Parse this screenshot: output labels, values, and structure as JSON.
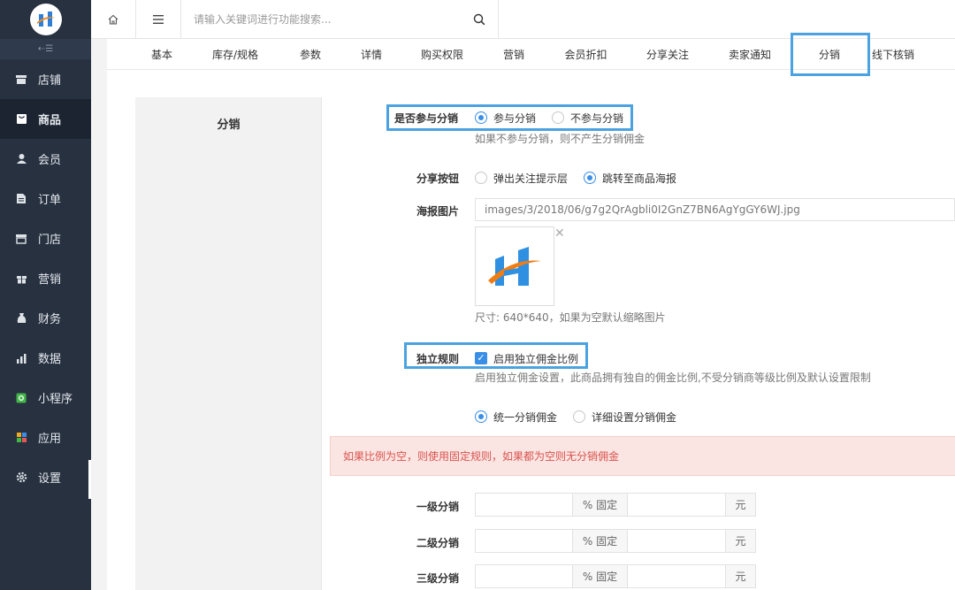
{
  "sidebar": {
    "collapse_icon": "collapse-icon",
    "items": [
      {
        "label": "店铺",
        "icon": "store-icon"
      },
      {
        "label": "商品",
        "icon": "goods-icon"
      },
      {
        "label": "会员",
        "icon": "member-icon"
      },
      {
        "label": "订单",
        "icon": "order-icon"
      },
      {
        "label": "门店",
        "icon": "shop-icon"
      },
      {
        "label": "营销",
        "icon": "gift-icon"
      },
      {
        "label": "财务",
        "icon": "money-bag-icon"
      },
      {
        "label": "数据",
        "icon": "chart-icon"
      },
      {
        "label": "小程序",
        "icon": "miniapp-icon"
      },
      {
        "label": "应用",
        "icon": "apps-icon"
      },
      {
        "label": "设置",
        "icon": "gear-icon"
      }
    ],
    "active_index": 1
  },
  "topbar": {
    "search_placeholder": "请输入关键词进行功能搜索..."
  },
  "tabs": [
    "基本",
    "库存/规格",
    "参数",
    "详情",
    "购买权限",
    "营销",
    "会员折扣",
    "分享关注",
    "卖家通知",
    "分销",
    "线下核销"
  ],
  "active_tab": "分销",
  "form": {
    "section_title": "分销",
    "participate": {
      "label": "是否参与分销",
      "option_yes": "参与分销",
      "option_no": "不参与分销",
      "hint": "如果不参与分销，则不产生分销佣金"
    },
    "share_button": {
      "label": "分享按钮",
      "option_popup": "弹出关注提示层",
      "option_poster": "跳转至商品海报"
    },
    "poster_image": {
      "label": "海报图片",
      "path": "images/3/2018/06/g7g2QrAgbli0I2GnZ7BN6AgYgGY6WJ.jpg",
      "remove_icon": "close-icon",
      "size_hint": "尺寸: 640*640，如果为空默认缩略图片"
    },
    "independent_rule": {
      "label": "独立规则",
      "checkbox_label": "启用独立佣金比例",
      "hint": "启用独立佣金设置，此商品拥有独自的佣金比例,不受分销商等级比例及默认设置限制",
      "option_unified": "统一分销佣金",
      "option_detailed": "详细设置分销佣金"
    },
    "alert": "如果比例为空，则使用固定规则，如果都为空则无分销佣金",
    "levels": [
      {
        "label": "一级分销",
        "percent_addon": "% 固定",
        "unit": "元"
      },
      {
        "label": "二级分销",
        "percent_addon": "% 固定",
        "unit": "元"
      },
      {
        "label": "三级分销",
        "percent_addon": "% 固定",
        "unit": "元"
      }
    ]
  },
  "colors": {
    "sidebar_bg": "#273140",
    "accent": "#3a8ee6",
    "highlight_box": "#4aa3e0",
    "alert_text": "#d9534f"
  }
}
